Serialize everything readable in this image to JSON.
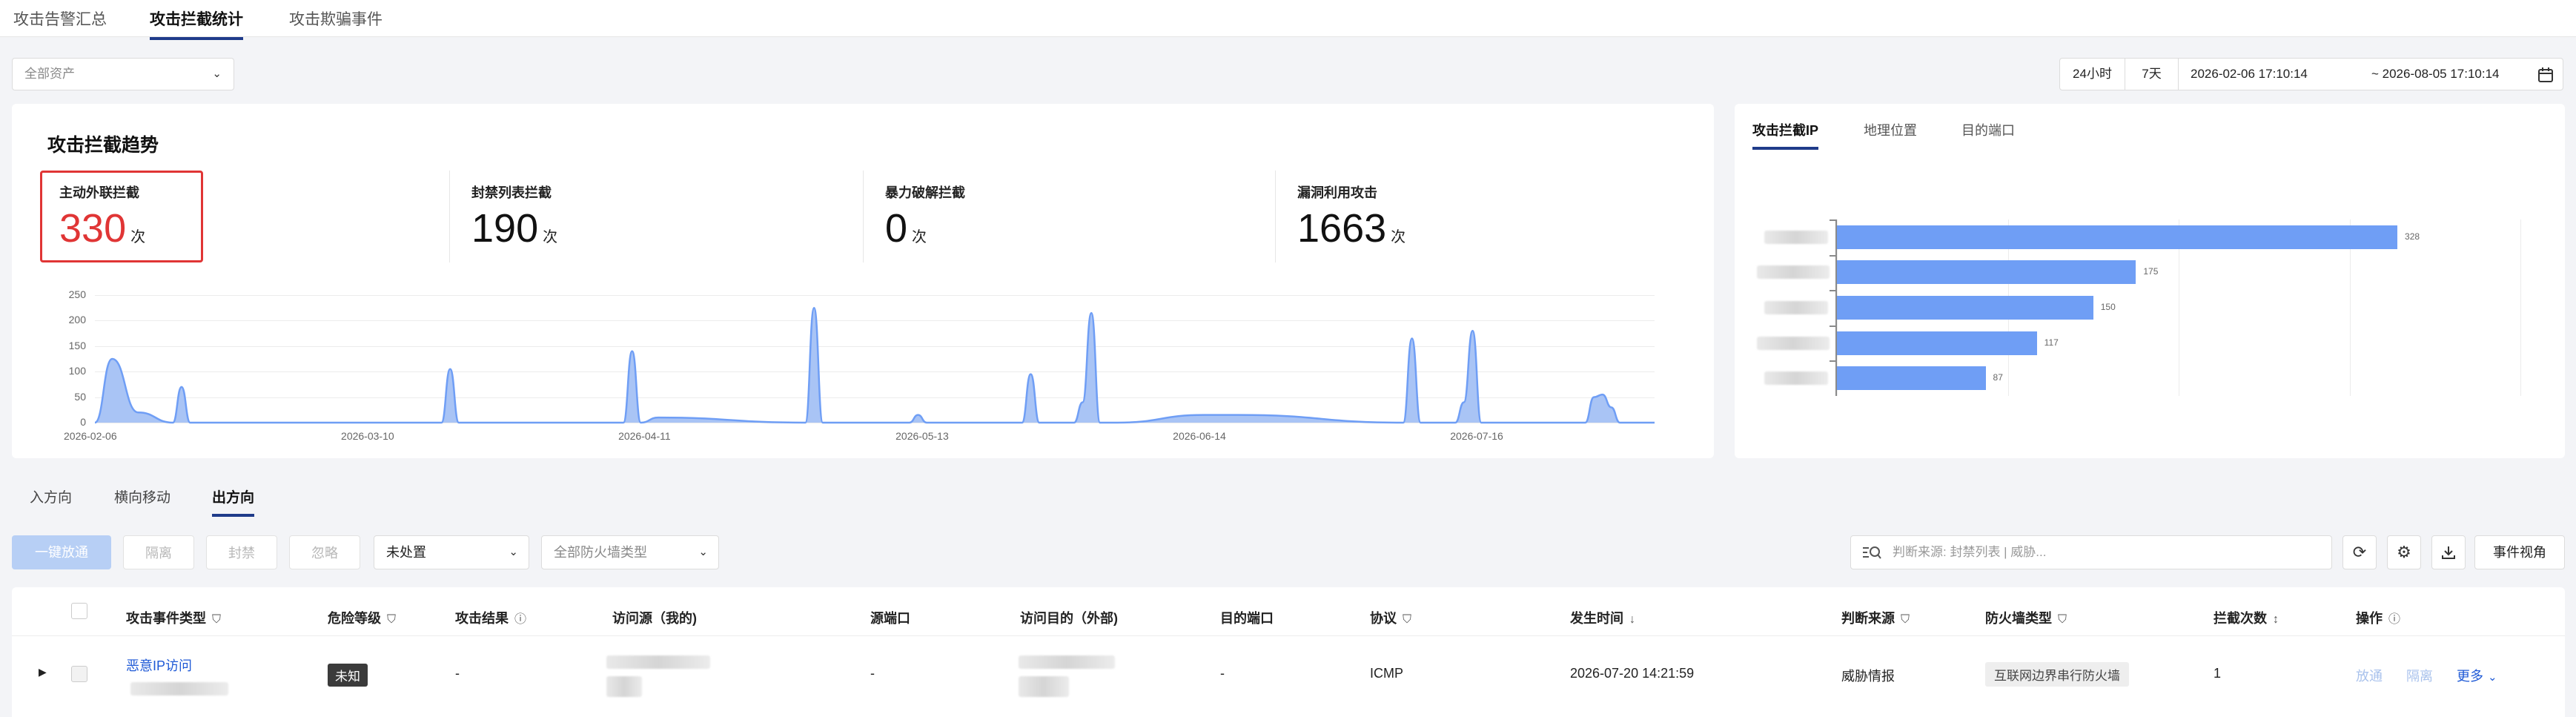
{
  "top_tabs": [
    {
      "label": "攻击告警汇总",
      "active": false
    },
    {
      "label": "攻击拦截统计",
      "active": true
    },
    {
      "label": "攻击欺骗事件",
      "active": false
    }
  ],
  "filters": {
    "asset_select": "全部资产",
    "range_buttons": [
      "24小时",
      "7天"
    ],
    "date_start": "2026-02-06 17:10:14",
    "date_end": "~ 2026-08-05 17:10:14"
  },
  "trend": {
    "title": "攻击拦截趋势",
    "unit": "次",
    "stats": [
      {
        "label": "主动外联拦截",
        "value": "330",
        "highlight": true
      },
      {
        "label": "封禁列表拦截",
        "value": "190",
        "highlight": false
      },
      {
        "label": "暴力破解拦截",
        "value": "0",
        "highlight": false
      },
      {
        "label": "漏洞利用攻击",
        "value": "1663",
        "highlight": false
      }
    ]
  },
  "chart_data": [
    {
      "type": "area",
      "title": "",
      "xlabel": "",
      "ylabel": "",
      "ylim": [
        0,
        250
      ],
      "yticks": [
        "0",
        "50",
        "100",
        "150",
        "200",
        "250"
      ],
      "x_tick_labels": [
        "2026-02-06",
        "2026-03-10",
        "2026-04-11",
        "2026-05-13",
        "2026-06-14",
        "2026-07-16"
      ],
      "grid": true,
      "color": "#6f9ef5",
      "x": [
        "2026-02-06",
        "2026-02-08",
        "2026-02-11",
        "2026-02-15",
        "2026-02-16",
        "2026-02-17",
        "2026-03-18",
        "2026-03-19",
        "2026-03-20",
        "2026-04-08",
        "2026-04-09",
        "2026-04-10",
        "2026-04-12",
        "2026-04-29",
        "2026-04-30",
        "2026-05-01",
        "2026-05-11",
        "2026-05-12",
        "2026-05-13",
        "2026-05-24",
        "2026-05-25",
        "2026-05-26",
        "2026-05-30",
        "2026-05-31",
        "2026-06-01",
        "2026-06-02",
        "2026-06-03",
        "2026-06-04",
        "2026-06-14",
        "2026-06-18",
        "2026-07-07",
        "2026-07-08",
        "2026-07-09",
        "2026-07-13",
        "2026-07-14",
        "2026-07-15",
        "2026-07-16",
        "2026-07-28",
        "2026-07-29",
        "2026-07-30",
        "2026-07-31",
        "2026-08-01",
        "2026-08-05"
      ],
      "values": [
        0,
        125,
        20,
        0,
        70,
        0,
        0,
        105,
        0,
        0,
        140,
        0,
        10,
        0,
        225,
        0,
        0,
        15,
        0,
        0,
        95,
        0,
        0,
        40,
        215,
        0,
        0,
        0,
        15,
        15,
        0,
        165,
        0,
        0,
        40,
        180,
        0,
        0,
        50,
        55,
        30,
        0,
        0
      ]
    },
    {
      "type": "bar",
      "orientation": "horizontal",
      "title": "",
      "xlabel": "",
      "ylabel": "",
      "grid": true,
      "color": "#6f9ef5",
      "categories": [
        "",
        "",
        "",
        "",
        ""
      ],
      "values": [
        328,
        175,
        150,
        117,
        87
      ],
      "xlim": [
        0,
        400
      ]
    }
  ],
  "right_tabs": [
    {
      "label": "攻击拦截IP",
      "active": true
    },
    {
      "label": "地理位置",
      "active": false
    },
    {
      "label": "目的端口",
      "active": false
    }
  ],
  "direction_tabs": [
    {
      "label": "入方向",
      "active": false
    },
    {
      "label": "横向移动",
      "active": false
    },
    {
      "label": "出方向",
      "active": true
    }
  ],
  "actions": {
    "release_all": "一键放通",
    "isolate": "隔离",
    "block": "封禁",
    "ignore": "忽略",
    "status_select": "未处置",
    "firewall_select": "全部防火墙类型",
    "search_placeholder": "判断来源: 封禁列表 | 威胁...",
    "event_view": "事件视角"
  },
  "table": {
    "headers": [
      "攻击事件类型",
      "危险等级",
      "攻击结果",
      "访问源（我的)",
      "源端口",
      "访问目的（外部)",
      "目的端口",
      "协议",
      "发生时间",
      "判断来源",
      "防火墙类型",
      "拦截次数",
      "操作"
    ],
    "row": {
      "event_type": "恶意IP访问",
      "level": "未知",
      "result": "-",
      "src_port": "-",
      "dst_port": "-",
      "protocol": "ICMP",
      "time": "2026-07-20 14:21:59",
      "source": "威胁情报",
      "firewall": "互联网边界串行防火墙",
      "count": "1",
      "op_release": "放通",
      "op_isolate": "隔离",
      "op_more": "更多"
    }
  }
}
